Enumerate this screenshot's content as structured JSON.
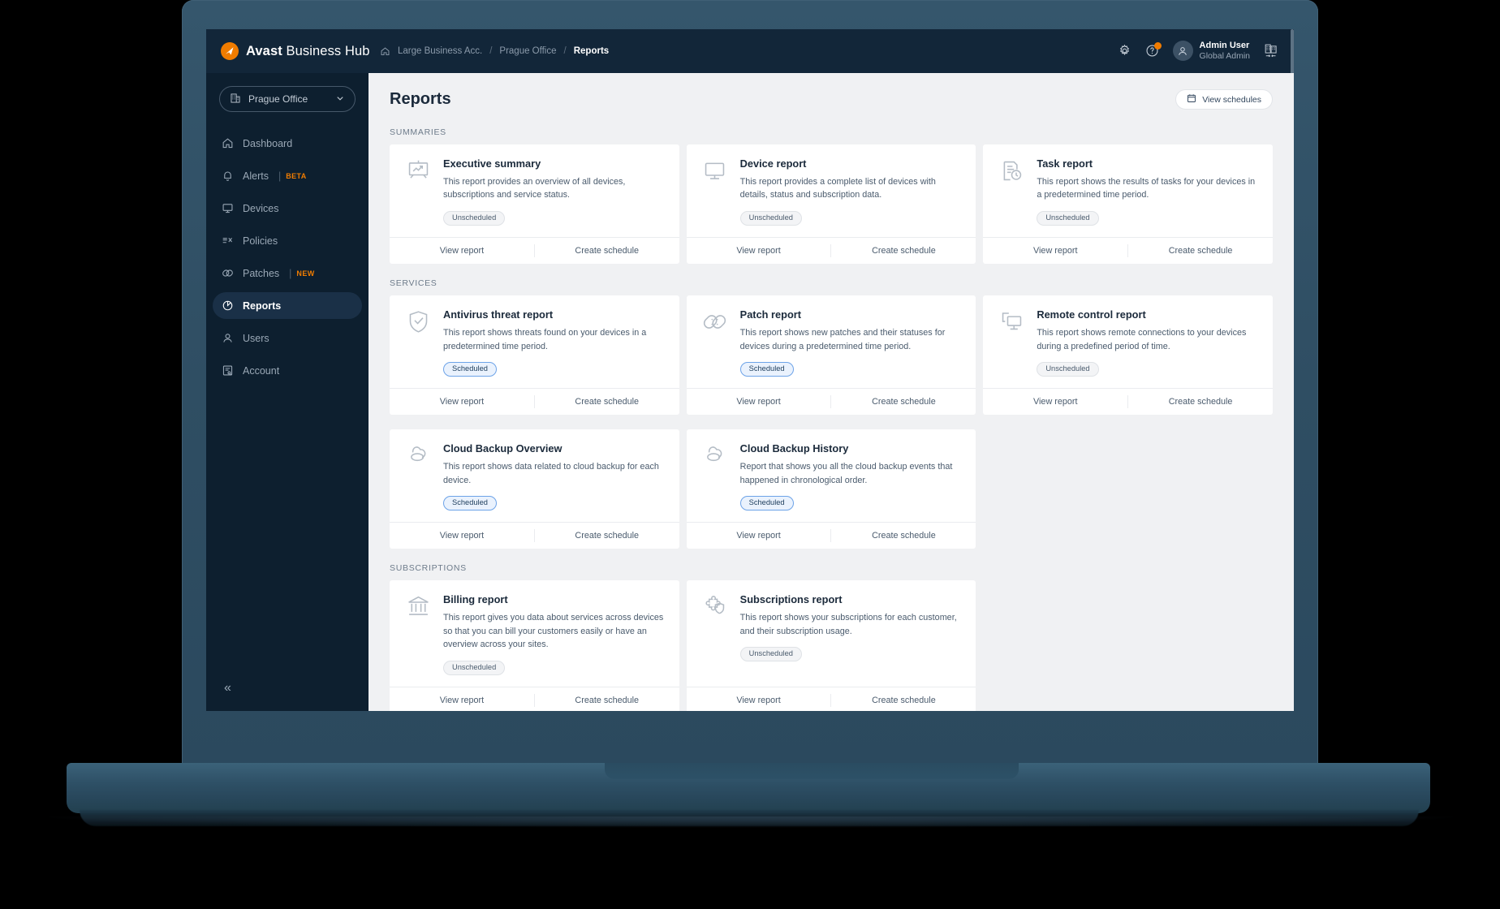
{
  "brand": {
    "name_bold": "Avast",
    "name_rest": " Business Hub",
    "logo_icon": "avast-swoosh-icon",
    "accent": "#f07c00"
  },
  "header": {
    "breadcrumb": {
      "home_icon": "home-icon",
      "items": [
        "Large Business Acc.",
        "Prague Office",
        "Reports"
      ],
      "separator": "/"
    },
    "settings_icon": "gear-icon",
    "help_icon": "help-circle-icon",
    "help_badge": true,
    "avatar_icon": "user-avatar-icon",
    "user_name": "Admin User",
    "user_role": "Global Admin",
    "company_switch_icon": "company-switch-icon"
  },
  "sidebar": {
    "office_selector": {
      "label": "Prague Office",
      "icon": "building-icon",
      "chevron": "chevron-down-icon"
    },
    "items": [
      {
        "label": "Dashboard",
        "icon": "home-icon",
        "active": false,
        "tag": ""
      },
      {
        "label": "Alerts",
        "icon": "bell-icon",
        "active": false,
        "tag": "BETA"
      },
      {
        "label": "Devices",
        "icon": "monitor-icon",
        "active": false,
        "tag": ""
      },
      {
        "label": "Policies",
        "icon": "policies-icon",
        "active": false,
        "tag": ""
      },
      {
        "label": "Patches",
        "icon": "patch-icon",
        "active": false,
        "tag": "NEW"
      },
      {
        "label": "Reports",
        "icon": "pie-chart-icon",
        "active": true,
        "tag": ""
      },
      {
        "label": "Users",
        "icon": "user-icon",
        "active": false,
        "tag": ""
      },
      {
        "label": "Account",
        "icon": "account-icon",
        "active": false,
        "tag": ""
      }
    ],
    "collapse_icon": "double-chevron-left-icon",
    "collapse_glyph": "«"
  },
  "page": {
    "title": "Reports",
    "view_schedules_button": {
      "label": "View schedules",
      "icon": "calendar-icon"
    },
    "actions": {
      "view_report": "View report",
      "create_schedule": "Create schedule"
    }
  },
  "sections": [
    {
      "label": "SUMMARIES",
      "cards": [
        {
          "title": "Executive summary",
          "desc": "This report provides an overview of all devices, subscriptions and service status.",
          "status": "Unscheduled",
          "status_kind": "unscheduled",
          "icon": "presentation-chart-icon"
        },
        {
          "title": "Device report",
          "desc": "This report provides a complete list of devices with details, status and subscription data.",
          "status": "Unscheduled",
          "status_kind": "unscheduled",
          "icon": "monitor-icon"
        },
        {
          "title": "Task report",
          "desc": "This report shows the results of tasks for your devices in a predetermined time period.",
          "status": "Unscheduled",
          "status_kind": "unscheduled",
          "icon": "document-clock-icon"
        }
      ]
    },
    {
      "label": "SERVICES",
      "cards": [
        {
          "title": "Antivirus threat report",
          "desc": "This report shows threats found on your devices in a predetermined time period.",
          "status": "Scheduled",
          "status_kind": "scheduled",
          "icon": "shield-check-icon"
        },
        {
          "title": "Patch report",
          "desc": "This report shows new patches and their statuses for devices during a predetermined time period.",
          "status": "Scheduled",
          "status_kind": "scheduled",
          "icon": "bandage-icon"
        },
        {
          "title": "Remote control report",
          "desc": "This report shows remote connections to your devices during a predefined period of time.",
          "status": "Unscheduled",
          "status_kind": "unscheduled",
          "icon": "remote-screens-icon"
        },
        {
          "title": "Cloud Backup Overview",
          "desc": "This report shows data related to cloud backup for each device.",
          "status": "Scheduled",
          "status_kind": "scheduled",
          "icon": "cloud-icon"
        },
        {
          "title": "Cloud Backup History",
          "desc": "Report that shows you all the cloud backup events that happened in chronological order.",
          "status": "Scheduled",
          "status_kind": "scheduled",
          "icon": "cloud-icon"
        }
      ]
    },
    {
      "label": "SUBSCRIPTIONS",
      "cards": [
        {
          "title": "Billing report",
          "desc": "This report gives you data about services across devices so that you can bill your customers easily or have an overview across your sites.",
          "status": "Unscheduled",
          "status_kind": "unscheduled",
          "icon": "bank-icon"
        },
        {
          "title": "Subscriptions report",
          "desc": "This report shows your subscriptions for each customer, and their subscription usage.",
          "status": "Unscheduled",
          "status_kind": "unscheduled",
          "icon": "puzzle-shield-icon"
        }
      ]
    }
  ],
  "colors": {
    "sidebar_bg": "#0d1f2f",
    "topbar_bg": "#122639",
    "content_bg": "#f0f1f3",
    "accent_orange": "#f07c00",
    "scheduled_border": "#6da3e8",
    "laptop_body": "#2f4e63"
  }
}
